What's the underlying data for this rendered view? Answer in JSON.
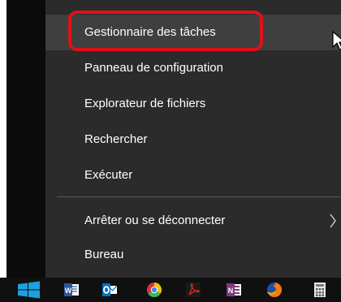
{
  "menu": {
    "items": [
      {
        "label": "Gestionnaire des tâches",
        "hover": true
      },
      {
        "label": "Panneau de configuration"
      },
      {
        "label": "Explorateur de fichiers"
      },
      {
        "label": "Rechercher"
      },
      {
        "label": "Exécuter"
      },
      {
        "label": "Arrêter ou se déconnecter",
        "submenu": true
      },
      {
        "label": "Bureau"
      }
    ]
  },
  "colors": {
    "menu_bg": "#2b2b2b",
    "hover_bg": "#3f3f3f",
    "highlight": "#e0101a",
    "windows_blue": "#1ba1e2"
  },
  "taskbar": {
    "icons": [
      "windows-start-icon",
      "word-icon",
      "outlook-icon",
      "chrome-icon",
      "acrobat-icon",
      "onenote-icon",
      "firefox-icon",
      "calculator-icon"
    ]
  }
}
